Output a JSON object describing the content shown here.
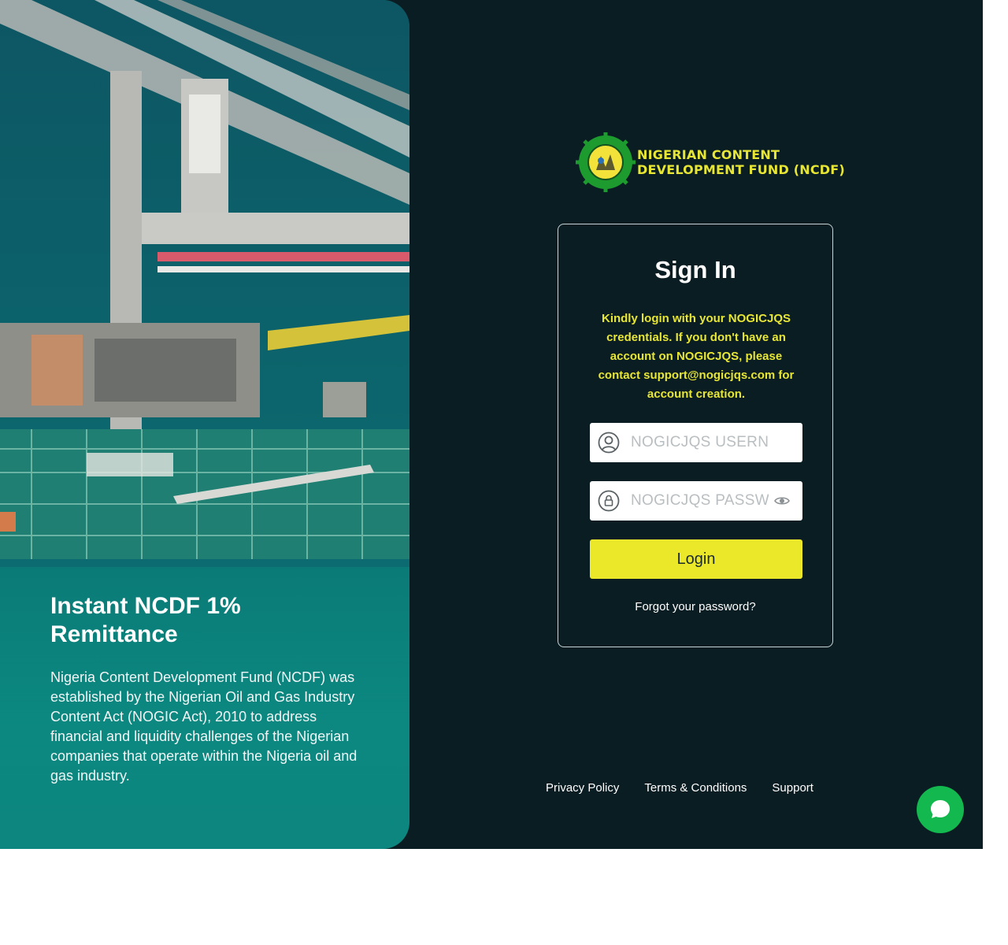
{
  "hero": {
    "title": "Instant NCDF 1% Remittance",
    "description": "Nigeria Content Development Fund (NCDF) was established by the Nigerian Oil and Gas Industry Content Act (NOGIC Act), 2010 to address financial and liquidity challenges of the Nigerian companies that operate within the Nigeria oil and gas industry."
  },
  "brand": {
    "line1": "NIGERIAN CONTENT",
    "line2": "DEVELOPMENT FUND (NCDF)"
  },
  "signin": {
    "title": "Sign In",
    "note": "Kindly login with your NOGICJQS credentials. If you don't have an account on NOGICJQS, please contact support@nogicjqs.com for account creation.",
    "username_placeholder": "NOGICJQS USERNAME",
    "username_value": "",
    "password_placeholder": "NOGICJQS PASSWORD",
    "password_value": "",
    "login_label": "Login",
    "forgot_label": "Forgot your password?"
  },
  "footer": {
    "privacy": "Privacy Policy",
    "terms": "Terms & Conditions",
    "support": "Support"
  },
  "icons": {
    "user": "user-circle-icon",
    "lock": "lock-icon",
    "eye": "eye-icon",
    "chat": "chat-bubble-icon"
  },
  "colors": {
    "background": "#0a1d23",
    "accent": "#ebe729",
    "chat": "#13b84e"
  }
}
